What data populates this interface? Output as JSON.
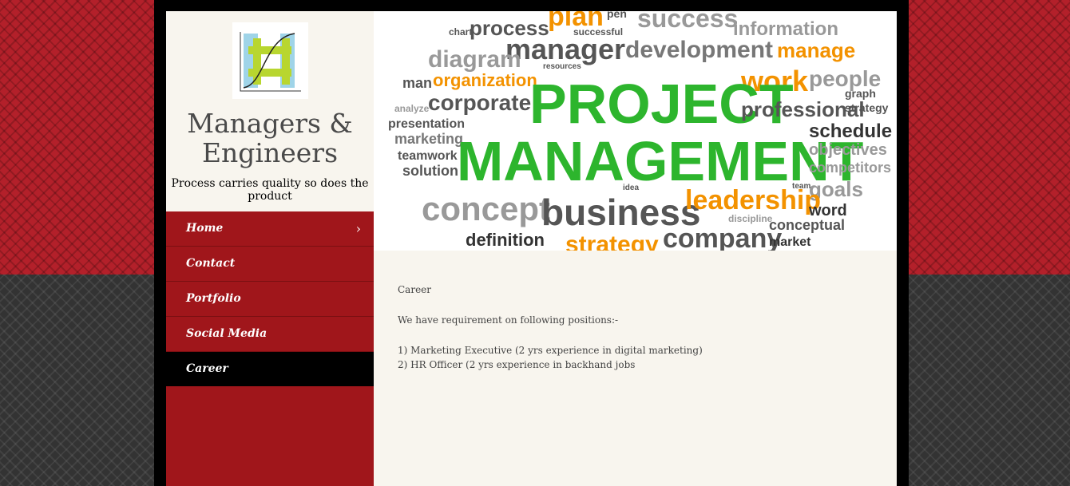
{
  "site": {
    "title": "Managers & Engineers",
    "tagline": "Process carries quality so does the product"
  },
  "nav": {
    "items": [
      {
        "label": "Home",
        "active": false
      },
      {
        "label": "Contact",
        "active": false
      },
      {
        "label": "Portfolio",
        "active": false
      },
      {
        "label": "Social Media",
        "active": false
      },
      {
        "label": "Career",
        "active": true
      }
    ],
    "home_chevron": "›"
  },
  "banner": {
    "headline_1": "PROJECT",
    "headline_2": "MANAGEMENT",
    "words": {
      "plan": "plan",
      "pen": "pen",
      "success": "success",
      "information": "information",
      "process": "process",
      "successful": "successful",
      "chart": "chart",
      "manager": "manager",
      "development": "development",
      "manage": "manage",
      "diagram": "diagram",
      "organization": "organization",
      "work": "work",
      "people": "people",
      "man": "man",
      "corporate": "corporate",
      "professional": "professional",
      "strategy": "strategy",
      "graph": "graph",
      "presentation": "presentation",
      "marketing": "marketing",
      "schedule": "schedule",
      "objectives": "objectives",
      "teamwork": "teamwork",
      "competitors": "competitors",
      "solution": "solution",
      "goals": "goals",
      "concept": "concept",
      "business": "business",
      "leadership": "leadership",
      "word": "word",
      "company": "company",
      "conceptual": "conceptual",
      "definition": "definition",
      "market": "market",
      "resources": "resources",
      "analyze": "analyze",
      "idea": "idea",
      "team": "team",
      "discipline": "discipline"
    }
  },
  "content": {
    "heading": "Career",
    "intro": "We have requirement on following positions:-",
    "positions": [
      "1) Marketing Executive (2 yrs experience in digital marketing)",
      "2) HR Officer (2 yrs experience in backhand jobs"
    ]
  },
  "colors": {
    "sidebar_red": "#a0161b",
    "brand_bg": "#f8f5ee",
    "word_green": "#2db52d",
    "word_orange": "#f39200",
    "word_gray": "#555555"
  }
}
